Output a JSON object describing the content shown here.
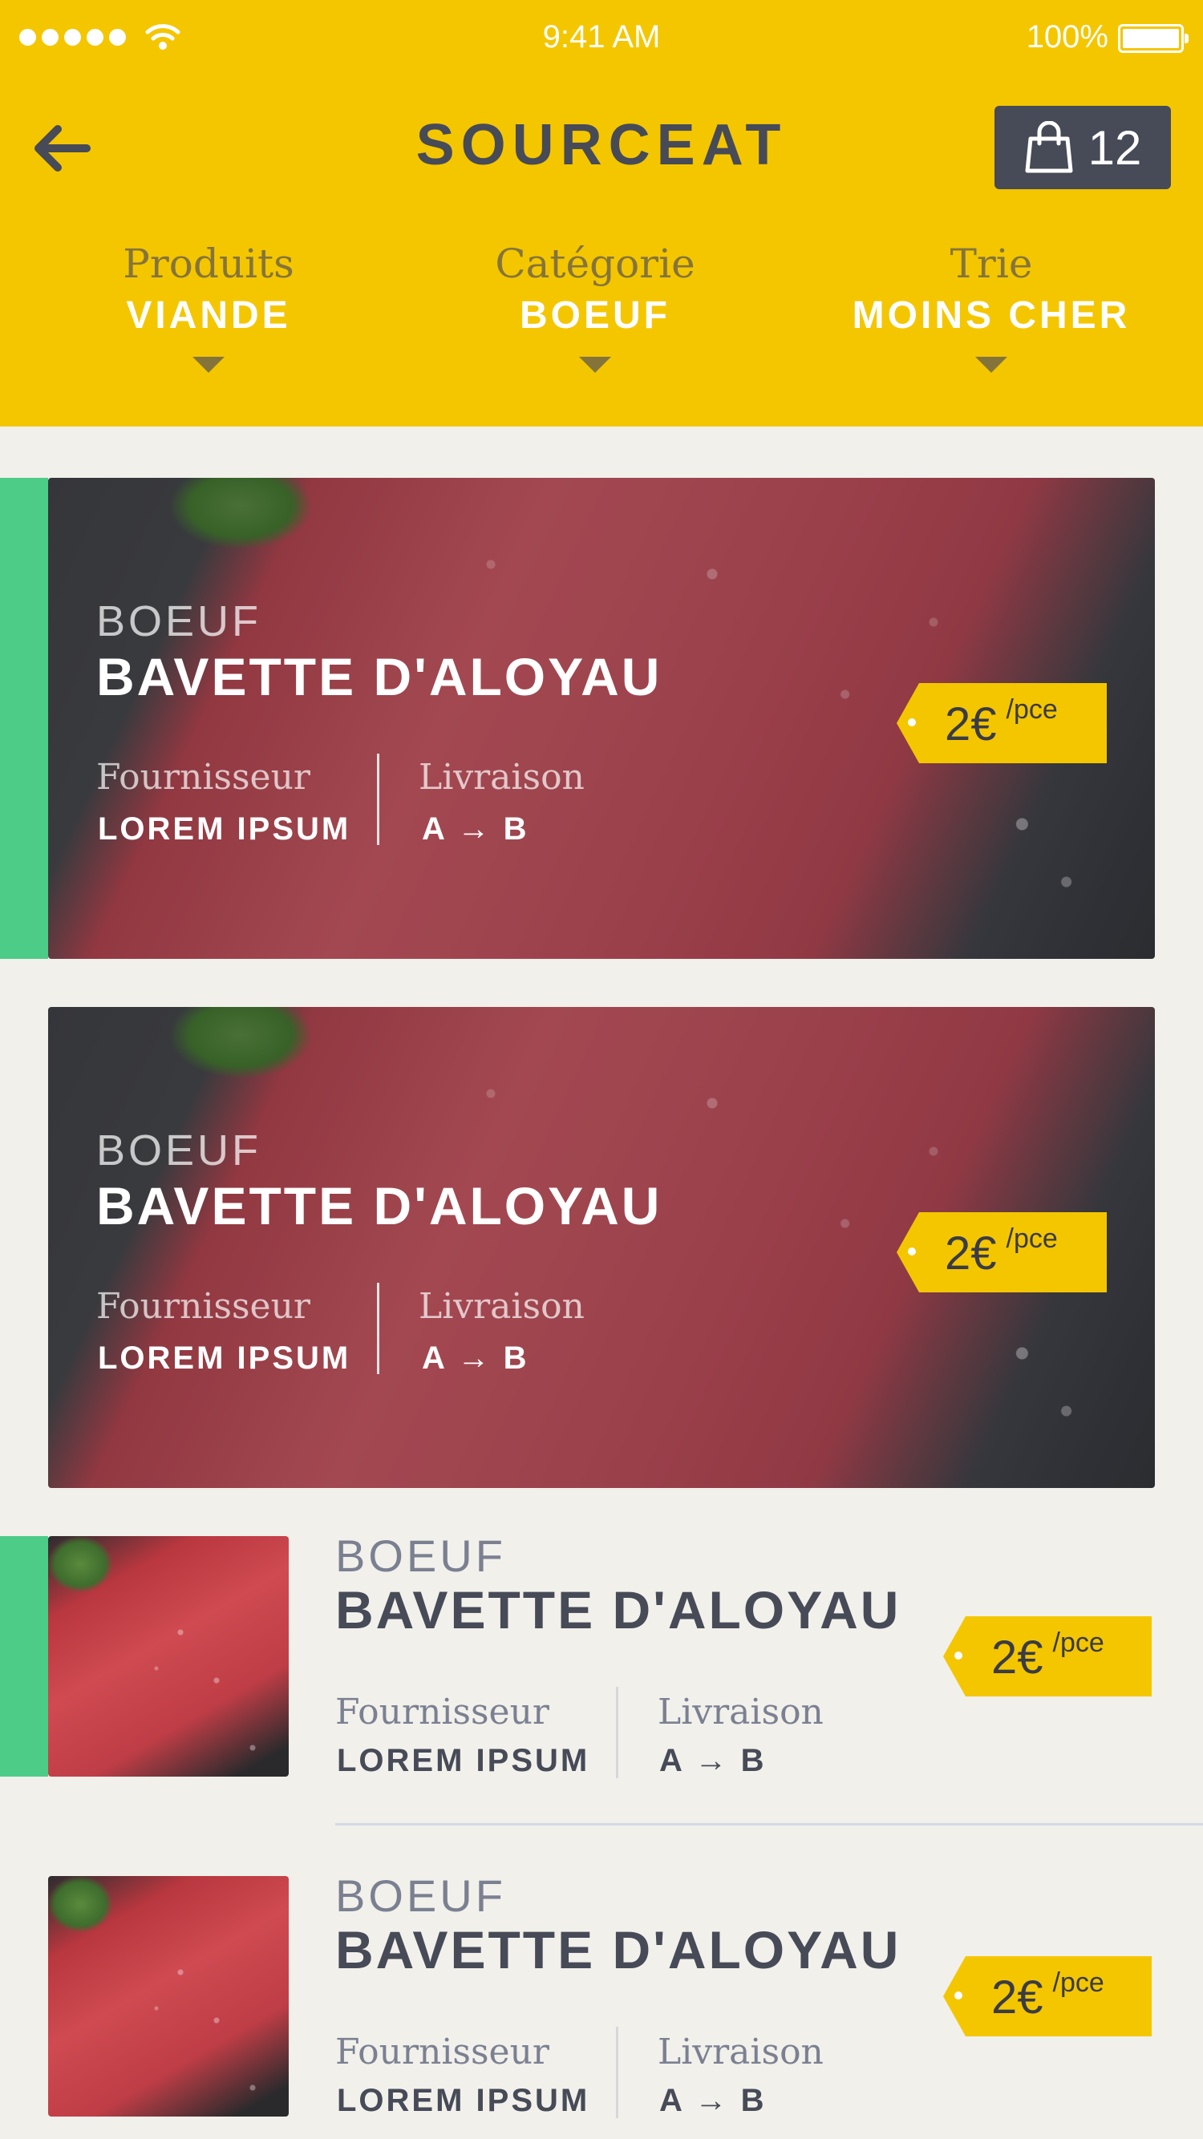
{
  "status_bar": {
    "time": "9:41 AM",
    "battery": "100%",
    "signal_icon": "signal-dots-icon",
    "wifi_icon": "wifi-icon"
  },
  "header": {
    "title": "SOURCEAT",
    "back_icon": "arrow-left-icon",
    "cart_icon": "shopping-bag-icon",
    "cart_count": "12",
    "background_color": "#f4c600"
  },
  "filters": [
    {
      "label": "Produits",
      "value": "VIANDE"
    },
    {
      "label": "Catégorie",
      "value": "BOEUF"
    },
    {
      "label": "Trie",
      "value": "MOINS CHER"
    }
  ],
  "products": [
    {
      "category": "BOEUF",
      "name": "BAVETTE D'ALOYAU",
      "supplier_label": "Fournisseur",
      "supplier": "LOREM IPSUM",
      "delivery_label": "Livraison",
      "delivery": "A → B",
      "price": "2€",
      "unit": "/pce",
      "highlighted": true
    },
    {
      "category": "BOEUF",
      "name": "BAVETTE D'ALOYAU",
      "supplier_label": "Fournisseur",
      "supplier": "LOREM IPSUM",
      "delivery_label": "Livraison",
      "delivery": "A → B",
      "price": "2€",
      "unit": "/pce",
      "highlighted": false
    },
    {
      "category": "BOEUF",
      "name": "BAVETTE D'ALOYAU",
      "supplier_label": "Fournisseur",
      "supplier": "LOREM IPSUM",
      "delivery_label": "Livraison",
      "delivery": "A → B",
      "price": "2€",
      "unit": "/pce",
      "highlighted": true
    },
    {
      "category": "BOEUF",
      "name": "BAVETTE D'ALOYAU",
      "supplier_label": "Fournisseur",
      "supplier": "LOREM IPSUM",
      "delivery_label": "Livraison",
      "delivery": "A → B",
      "price": "2€",
      "unit": "/pce",
      "highlighted": false
    }
  ],
  "colors": {
    "accent_yellow": "#f4c600",
    "highlight_green": "#4ccc87",
    "dark_text": "#474a57"
  }
}
